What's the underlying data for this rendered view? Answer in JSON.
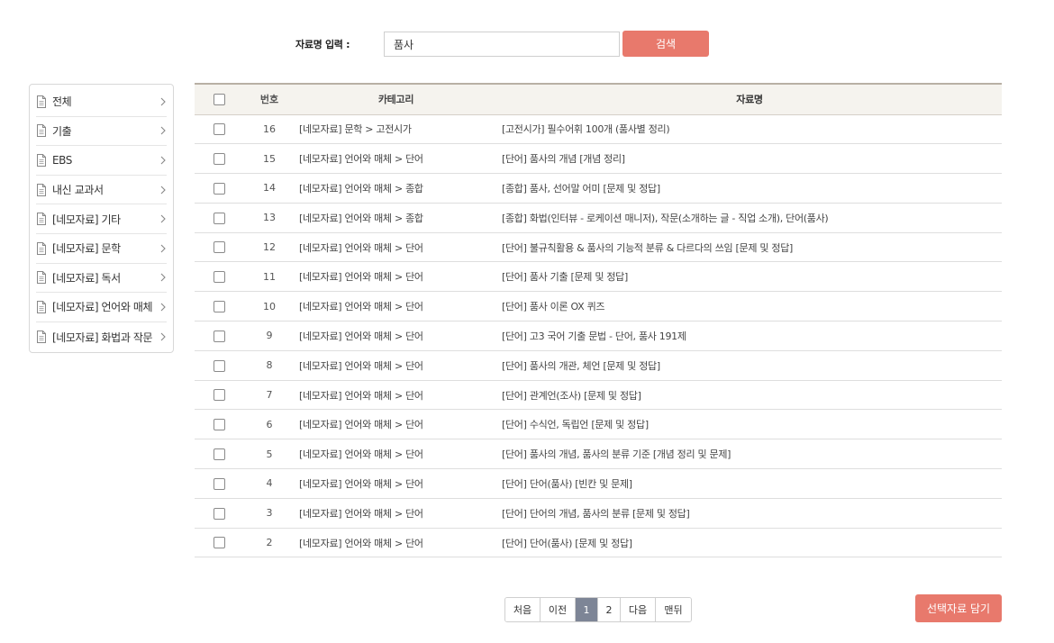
{
  "search": {
    "label": "자료명 입력 :",
    "value": "품사",
    "button_label": "검색"
  },
  "sidebar": {
    "items": [
      {
        "label": "전체"
      },
      {
        "label": "기출"
      },
      {
        "label": "EBS"
      },
      {
        "label": "내신 교과서"
      },
      {
        "label": "[네모자료] 기타"
      },
      {
        "label": "[네모자료] 문학"
      },
      {
        "label": "[네모자료] 독서"
      },
      {
        "label": "[네모자료] 언어와 매체"
      },
      {
        "label": "[네모자료] 화법과 작문"
      }
    ]
  },
  "table": {
    "headers": {
      "num": "번호",
      "category": "카테고리",
      "title": "자료명"
    },
    "rows": [
      {
        "num": "16",
        "category": "[네모자료] 문학 > 고전시가",
        "title": "[고전시가] 필수어휘 100개 (품사별 정리)"
      },
      {
        "num": "15",
        "category": "[네모자료] 언어와 매체 > 단어",
        "title": "[단어] 품사의 개념 [개념 정리]"
      },
      {
        "num": "14",
        "category": "[네모자료] 언어와 매체 > 종합",
        "title": "[종합] 품사, 선어말 어미 [문제 및 정답]"
      },
      {
        "num": "13",
        "category": "[네모자료] 언어와 매체 > 종합",
        "title": "[종합] 화법(인터뷰 - 로케이션 매니저), 작문(소개하는 글 - 직업 소개), 단어(품사)"
      },
      {
        "num": "12",
        "category": "[네모자료] 언어와 매체 > 단어",
        "title": "[단어] 불규칙활용 & 품사의 기능적 분류 & 다르다의 쓰임 [문제 및 정답]"
      },
      {
        "num": "11",
        "category": "[네모자료] 언어와 매체 > 단어",
        "title": "[단어] 품사 기출 [문제 및 정답]"
      },
      {
        "num": "10",
        "category": "[네모자료] 언어와 매체 > 단어",
        "title": "[단어] 품사 이론 OX 퀴즈"
      },
      {
        "num": "9",
        "category": "[네모자료] 언어와 매체 > 단어",
        "title": "[단어] 고3 국어 기출 문법 - 단어, 품사 191제"
      },
      {
        "num": "8",
        "category": "[네모자료] 언어와 매체 > 단어",
        "title": "[단어] 품사의 개관, 체언 [문제 및 정답]"
      },
      {
        "num": "7",
        "category": "[네모자료] 언어와 매체 > 단어",
        "title": "[단어] 관계언(조사) [문제 및 정답]"
      },
      {
        "num": "6",
        "category": "[네모자료] 언어와 매체 > 단어",
        "title": "[단어] 수식언, 독립언 [문제 및 정답]"
      },
      {
        "num": "5",
        "category": "[네모자료] 언어와 매체 > 단어",
        "title": "[단어] 품사의 개념, 품사의 분류 기준 [개념 정리 및 문제]"
      },
      {
        "num": "4",
        "category": "[네모자료] 언어와 매체 > 단어",
        "title": "[단어] 단어(품사) [빈칸 및 문제]"
      },
      {
        "num": "3",
        "category": "[네모자료] 언어와 매체 > 단어",
        "title": "[단어] 단어의 개념, 품사의 분류 [문제 및 정답]"
      },
      {
        "num": "2",
        "category": "[네모자료] 언어와 매체 > 단어",
        "title": "[단어] 단어(품사) [문제 및 정답]"
      }
    ]
  },
  "pagination": {
    "first": "처음",
    "prev": "이전",
    "pages": [
      "1",
      "2"
    ],
    "current": "1",
    "next": "다음",
    "last": "맨뒤"
  },
  "actions": {
    "add_selected_label": "선택자료 담기"
  },
  "colors": {
    "accent": "#e8796c",
    "pager_active": "#7d8596",
    "header_bg": "#f5f3ee"
  }
}
